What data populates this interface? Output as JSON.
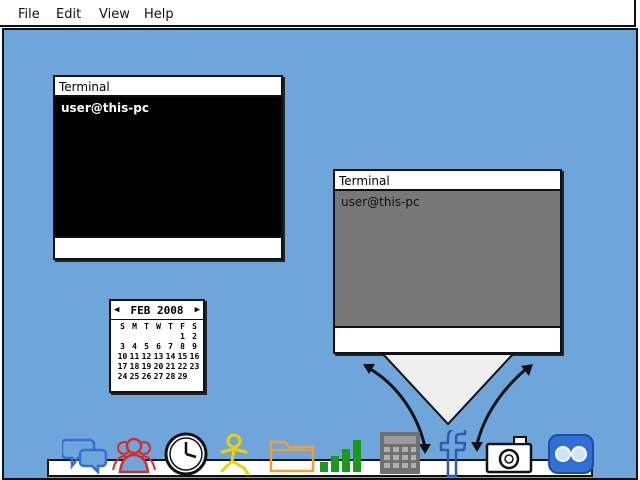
{
  "menu": [
    {
      "label": "File"
    },
    {
      "label": "Edit"
    },
    {
      "label": "View"
    },
    {
      "label": "Help"
    }
  ],
  "windows": [
    {
      "title": "Terminal",
      "prompt": "user@this-pc",
      "state": "active",
      "body_color": "#000000"
    },
    {
      "title": "Terminal",
      "prompt": "user@this-pc",
      "state": "inactive",
      "body_color": "#777777"
    }
  ],
  "calendar": {
    "month_label": "FEB 2008",
    "weekdays": [
      "S",
      "M",
      "T",
      "W",
      "T",
      "F",
      "S"
    ],
    "days": [
      "",
      "",
      "",
      "",
      "",
      "1",
      "2",
      "3",
      "4",
      "5",
      "6",
      "7",
      "8",
      "9",
      "10",
      "11",
      "12",
      "13",
      "14",
      "15",
      "16",
      "17",
      "18",
      "19",
      "20",
      "21",
      "22",
      "23",
      "24",
      "25",
      "26",
      "27",
      "28",
      "29"
    ]
  },
  "dock": {
    "icons": [
      "chat-icon",
      "contacts-icon",
      "clock-icon",
      "buddy-icon",
      "folder-icon",
      "signal-icon",
      "calculator-icon",
      "facebook-icon",
      "camera-icon",
      "messenger-icon"
    ]
  },
  "colors": {
    "desktop": "#6ea6dc",
    "terminal_active": "#000000",
    "terminal_inactive": "#777777",
    "chat": "#2f6fd6",
    "contacts": "#d42b2b",
    "buddy": "#f0d000",
    "folder": "#f0a030",
    "signal": "#1a9a1a",
    "calculator": "#707070",
    "facebook": "#2a5db0"
  }
}
